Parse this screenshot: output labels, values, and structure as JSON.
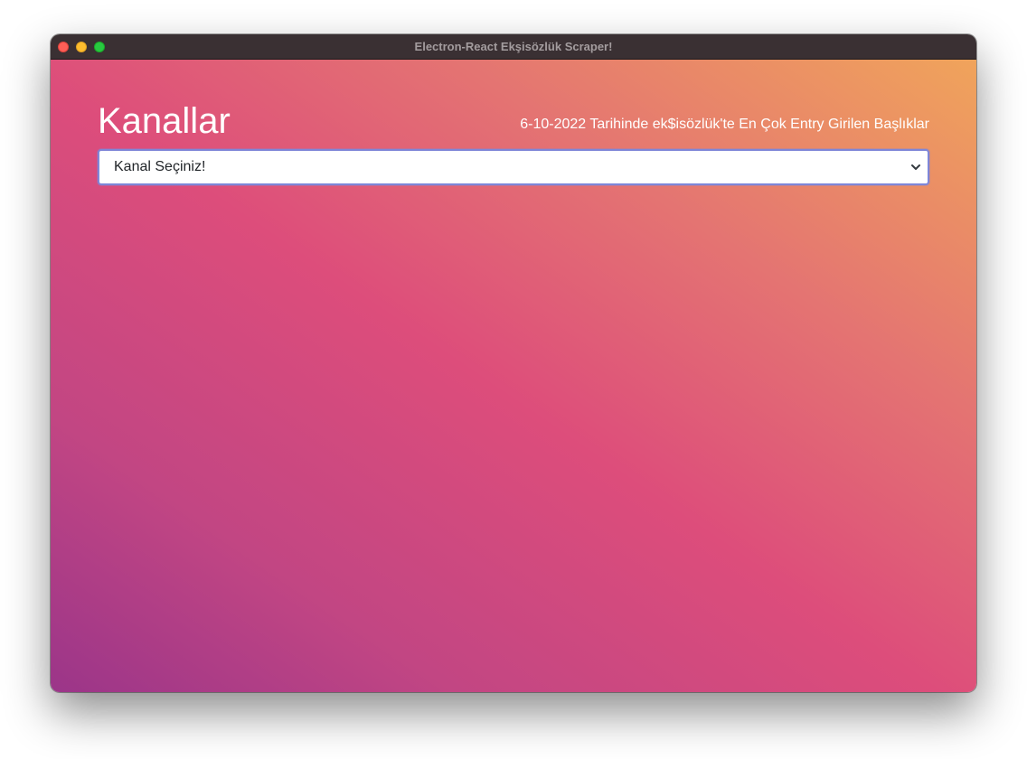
{
  "window": {
    "title": "Electron-React Ekşisözlük Scraper!"
  },
  "main": {
    "heading": "Kanallar",
    "subheading": "6-10-2022 Tarihinde ek$isözlük'te En Çok Entry Girilen Başlıklar",
    "channel_select": {
      "selected": "Kanal Seçiniz!"
    }
  },
  "colors": {
    "gradient_bottom_left": "#9b3589",
    "gradient_middle": "#dd4d7b",
    "gradient_top_right": "#f0a45b",
    "titlebar": "#3a3033",
    "select_border": "#7e86d8"
  }
}
